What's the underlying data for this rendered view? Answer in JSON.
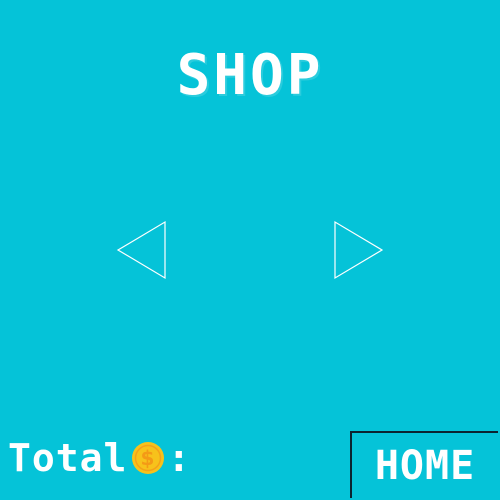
{
  "screen": {
    "title": "SHOP",
    "background_color": "#05c3d8"
  },
  "navigation": {
    "prev_icon": "triangle-left-outline-icon",
    "next_icon": "triangle-right-outline-icon"
  },
  "footer": {
    "total_label": "Total",
    "coin_icon": "dollar-coin-icon",
    "colon": ":",
    "home_label": "HOME"
  },
  "colors": {
    "text": "#ffffff",
    "coin": "#f7c21b",
    "button_border": "#0b2430"
  }
}
